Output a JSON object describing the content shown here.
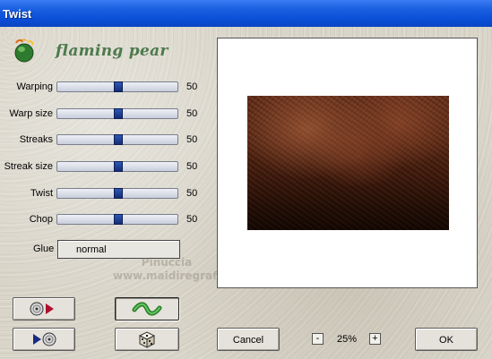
{
  "window": {
    "title": "Twist"
  },
  "brand": {
    "name": "flaming pear",
    "logo_icon": "flaming-pear-logo-icon"
  },
  "params": [
    {
      "label": "Warping",
      "value": "50",
      "level": 0.5
    },
    {
      "label": "Warp size",
      "value": "50",
      "level": 0.5
    },
    {
      "label": "Streaks",
      "value": "50",
      "level": 0.5
    },
    {
      "label": "Streak size",
      "value": "50",
      "level": 0.5
    },
    {
      "label": "Twist",
      "value": "50",
      "level": 0.5
    },
    {
      "label": "Chop",
      "value": "50",
      "level": 0.5
    }
  ],
  "glue": {
    "label": "Glue",
    "value": "normal"
  },
  "buttons": {
    "load_preset_icon": "disc-load-icon",
    "save_preset_icon": "disc-save-icon",
    "random_icon": "dice-icon",
    "preview_toggle_icon": "green-wave-icon",
    "cancel": "Cancel",
    "ok": "OK"
  },
  "zoom": {
    "value": "25%",
    "minus": "-",
    "plus": "+"
  },
  "watermark": {
    "line1": "Pinuccia",
    "line2": "www.maidiregrafica.eu"
  },
  "colors": {
    "titlebar": "#0a4fd8",
    "slider_thumb": "#1e3f96",
    "brand": "#4c7a4c"
  }
}
